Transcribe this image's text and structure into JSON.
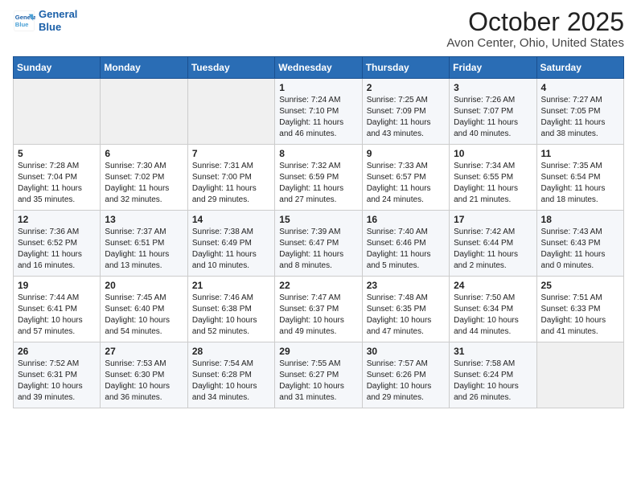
{
  "header": {
    "logo_line1": "General",
    "logo_line2": "Blue",
    "title": "October 2025",
    "subtitle": "Avon Center, Ohio, United States"
  },
  "days_of_week": [
    "Sunday",
    "Monday",
    "Tuesday",
    "Wednesday",
    "Thursday",
    "Friday",
    "Saturday"
  ],
  "weeks": [
    [
      {
        "day": "",
        "info": ""
      },
      {
        "day": "",
        "info": ""
      },
      {
        "day": "",
        "info": ""
      },
      {
        "day": "1",
        "info": "Sunrise: 7:24 AM\nSunset: 7:10 PM\nDaylight: 11 hours\nand 46 minutes."
      },
      {
        "day": "2",
        "info": "Sunrise: 7:25 AM\nSunset: 7:09 PM\nDaylight: 11 hours\nand 43 minutes."
      },
      {
        "day": "3",
        "info": "Sunrise: 7:26 AM\nSunset: 7:07 PM\nDaylight: 11 hours\nand 40 minutes."
      },
      {
        "day": "4",
        "info": "Sunrise: 7:27 AM\nSunset: 7:05 PM\nDaylight: 11 hours\nand 38 minutes."
      }
    ],
    [
      {
        "day": "5",
        "info": "Sunrise: 7:28 AM\nSunset: 7:04 PM\nDaylight: 11 hours\nand 35 minutes."
      },
      {
        "day": "6",
        "info": "Sunrise: 7:30 AM\nSunset: 7:02 PM\nDaylight: 11 hours\nand 32 minutes."
      },
      {
        "day": "7",
        "info": "Sunrise: 7:31 AM\nSunset: 7:00 PM\nDaylight: 11 hours\nand 29 minutes."
      },
      {
        "day": "8",
        "info": "Sunrise: 7:32 AM\nSunset: 6:59 PM\nDaylight: 11 hours\nand 27 minutes."
      },
      {
        "day": "9",
        "info": "Sunrise: 7:33 AM\nSunset: 6:57 PM\nDaylight: 11 hours\nand 24 minutes."
      },
      {
        "day": "10",
        "info": "Sunrise: 7:34 AM\nSunset: 6:55 PM\nDaylight: 11 hours\nand 21 minutes."
      },
      {
        "day": "11",
        "info": "Sunrise: 7:35 AM\nSunset: 6:54 PM\nDaylight: 11 hours\nand 18 minutes."
      }
    ],
    [
      {
        "day": "12",
        "info": "Sunrise: 7:36 AM\nSunset: 6:52 PM\nDaylight: 11 hours\nand 16 minutes."
      },
      {
        "day": "13",
        "info": "Sunrise: 7:37 AM\nSunset: 6:51 PM\nDaylight: 11 hours\nand 13 minutes."
      },
      {
        "day": "14",
        "info": "Sunrise: 7:38 AM\nSunset: 6:49 PM\nDaylight: 11 hours\nand 10 minutes."
      },
      {
        "day": "15",
        "info": "Sunrise: 7:39 AM\nSunset: 6:47 PM\nDaylight: 11 hours\nand 8 minutes."
      },
      {
        "day": "16",
        "info": "Sunrise: 7:40 AM\nSunset: 6:46 PM\nDaylight: 11 hours\nand 5 minutes."
      },
      {
        "day": "17",
        "info": "Sunrise: 7:42 AM\nSunset: 6:44 PM\nDaylight: 11 hours\nand 2 minutes."
      },
      {
        "day": "18",
        "info": "Sunrise: 7:43 AM\nSunset: 6:43 PM\nDaylight: 11 hours\nand 0 minutes."
      }
    ],
    [
      {
        "day": "19",
        "info": "Sunrise: 7:44 AM\nSunset: 6:41 PM\nDaylight: 10 hours\nand 57 minutes."
      },
      {
        "day": "20",
        "info": "Sunrise: 7:45 AM\nSunset: 6:40 PM\nDaylight: 10 hours\nand 54 minutes."
      },
      {
        "day": "21",
        "info": "Sunrise: 7:46 AM\nSunset: 6:38 PM\nDaylight: 10 hours\nand 52 minutes."
      },
      {
        "day": "22",
        "info": "Sunrise: 7:47 AM\nSunset: 6:37 PM\nDaylight: 10 hours\nand 49 minutes."
      },
      {
        "day": "23",
        "info": "Sunrise: 7:48 AM\nSunset: 6:35 PM\nDaylight: 10 hours\nand 47 minutes."
      },
      {
        "day": "24",
        "info": "Sunrise: 7:50 AM\nSunset: 6:34 PM\nDaylight: 10 hours\nand 44 minutes."
      },
      {
        "day": "25",
        "info": "Sunrise: 7:51 AM\nSunset: 6:33 PM\nDaylight: 10 hours\nand 41 minutes."
      }
    ],
    [
      {
        "day": "26",
        "info": "Sunrise: 7:52 AM\nSunset: 6:31 PM\nDaylight: 10 hours\nand 39 minutes."
      },
      {
        "day": "27",
        "info": "Sunrise: 7:53 AM\nSunset: 6:30 PM\nDaylight: 10 hours\nand 36 minutes."
      },
      {
        "day": "28",
        "info": "Sunrise: 7:54 AM\nSunset: 6:28 PM\nDaylight: 10 hours\nand 34 minutes."
      },
      {
        "day": "29",
        "info": "Sunrise: 7:55 AM\nSunset: 6:27 PM\nDaylight: 10 hours\nand 31 minutes."
      },
      {
        "day": "30",
        "info": "Sunrise: 7:57 AM\nSunset: 6:26 PM\nDaylight: 10 hours\nand 29 minutes."
      },
      {
        "day": "31",
        "info": "Sunrise: 7:58 AM\nSunset: 6:24 PM\nDaylight: 10 hours\nand 26 minutes."
      },
      {
        "day": "",
        "info": ""
      }
    ]
  ]
}
